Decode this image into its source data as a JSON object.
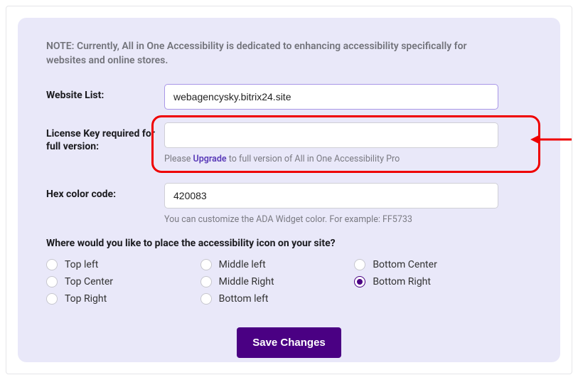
{
  "note": "NOTE: Currently, All in One Accessibility is dedicated to enhancing accessibility specifically for websites and online stores.",
  "fields": {
    "website": {
      "label": "Website List:",
      "value": "webagencysky.bitrix24.site"
    },
    "license": {
      "label": "License Key required for full version:",
      "value": "",
      "help_prefix": "Please ",
      "help_link": "Upgrade",
      "help_suffix": " to full version of All in One Accessibility Pro"
    },
    "hex": {
      "label": "Hex color code:",
      "value": "420083",
      "help": "You can customize the ADA Widget color. For example: FF5733"
    }
  },
  "placement": {
    "question": "Where would you like to place the accessibility icon on your site?",
    "options": [
      {
        "id": "top-left",
        "label": "Top left",
        "col": 0
      },
      {
        "id": "top-center",
        "label": "Top Center",
        "col": 0
      },
      {
        "id": "top-right",
        "label": "Top Right",
        "col": 0
      },
      {
        "id": "middle-left",
        "label": "Middle left",
        "col": 1
      },
      {
        "id": "middle-right",
        "label": "Middle Right",
        "col": 1
      },
      {
        "id": "bottom-left",
        "label": "Bottom left",
        "col": 1
      },
      {
        "id": "bottom-center",
        "label": "Bottom Center",
        "col": 2
      },
      {
        "id": "bottom-right",
        "label": "Bottom Right",
        "col": 2
      }
    ],
    "selected": "bottom-right"
  },
  "save_label": "Save Changes"
}
